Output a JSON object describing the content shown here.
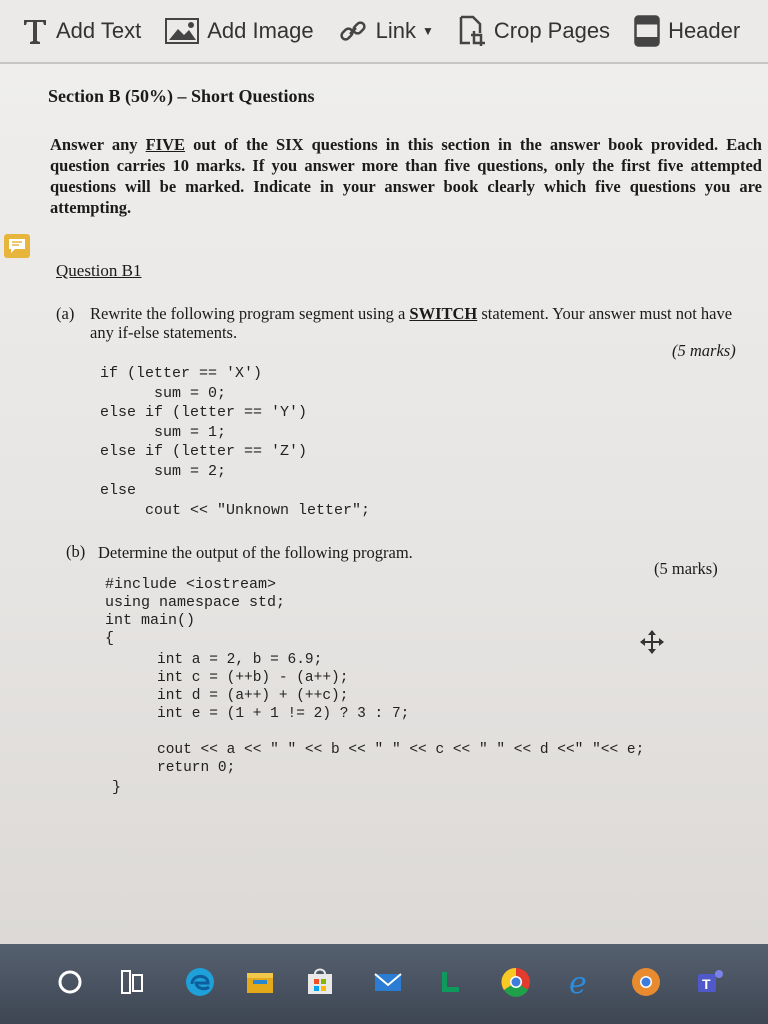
{
  "toolbar": {
    "add_text": "Add Text",
    "add_image": "Add Image",
    "link": "Link",
    "crop_pages": "Crop Pages",
    "header": "Header"
  },
  "document": {
    "section_title": "Section B (50%) – Short Questions",
    "instructions_1": "Answer any ",
    "instructions_five": "FIVE",
    "instructions_2": " out of the SIX questions in this section in the answer book provided. Each question carries 10 marks. If you answer more than five questions, only the first five attempted questions will be marked. Indicate in your answer book clearly which five questions you are attempting.",
    "question_title": "Question B1",
    "part_a": {
      "label": "(a)",
      "text_1": "Rewrite the following program segment using a ",
      "text_switch": "SWITCH",
      "text_2": " statement. Your answer must not have any if-else statements.",
      "marks": "(5 marks)",
      "code": [
        "if (letter == 'X')",
        "      sum = 0;",
        "else if (letter == 'Y')",
        "      sum = 1;",
        "else if (letter == 'Z')",
        "      sum = 2;",
        "else",
        "     cout << \"Unknown letter\";"
      ]
    },
    "part_b": {
      "label": "(b)",
      "text": "Determine the output of the following program.",
      "marks": "(5 marks)",
      "code_head": [
        "#include <iostream>",
        "using namespace std;",
        "int main()",
        "{"
      ],
      "code_body": [
        "int a = 2, b = 6.9;",
        "int c = (++b) - (a++);",
        "int d = (a++) + (++c);",
        "int e = (1 + 1 != 2) ? 3 : 7;",
        "",
        "cout << a << \" \" << b << \" \" << c << \" \" << d <<\" \"<< e;",
        "return 0;"
      ],
      "code_end": "}"
    }
  },
  "colors": {
    "toolbar_bg": "#eceae8",
    "page_bg": "#e9e7e5",
    "comment_icon": "#e8b53c",
    "taskbar_bg": "#46505d"
  },
  "taskbar_icons": [
    "search-circle-icon",
    "task-view-icon",
    "edge-icon",
    "file-explorer-icon",
    "store-icon",
    "mail-icon",
    "teams-flow-icon",
    "chrome-icon",
    "internet-explorer-icon",
    "chrome-2-icon",
    "teams-icon"
  ]
}
